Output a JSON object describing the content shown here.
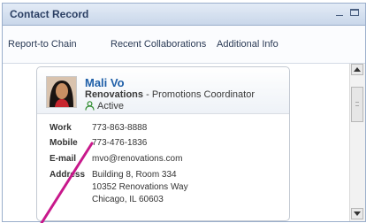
{
  "window": {
    "title": "Contact Record"
  },
  "tabs": [
    {
      "label": "Report-to Chain"
    },
    {
      "label": "Recent Collaborations"
    },
    {
      "label": "Additional Info"
    }
  ],
  "contact": {
    "name": "Mali Vo",
    "organization": "Renovations",
    "separator": "-",
    "role": "Promotions Coordinator",
    "status": "Active",
    "fields": [
      {
        "label": "Work",
        "value": "773-863-8888"
      },
      {
        "label": "Mobile",
        "value": "773-476-1836"
      },
      {
        "label": "E-mail",
        "value": "mvo@renovations.com"
      },
      {
        "label": "Address",
        "lines": [
          "Building 8, Room 334",
          "10352 Renovations Way",
          "Chicago, IL  60603"
        ]
      }
    ]
  },
  "colors": {
    "accent": "#1f5fa8",
    "annotation": "#c8188b",
    "status": "#2e8b2e"
  },
  "icons": {
    "status": "person-icon"
  }
}
